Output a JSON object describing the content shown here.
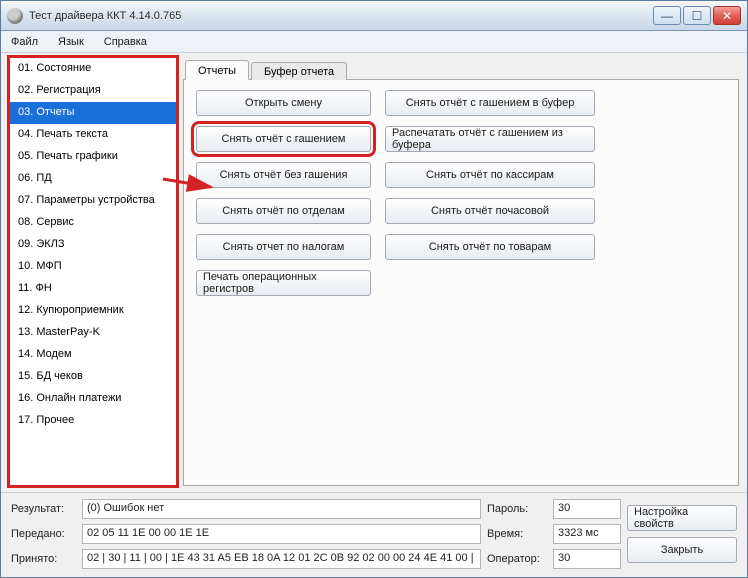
{
  "window": {
    "title": "Тест драйвера ККТ 4.14.0.765"
  },
  "menu": {
    "file": "Файл",
    "lang": "Язык",
    "help": "Справка"
  },
  "sidebar": {
    "items": [
      "01. Состояние",
      "02. Регистрация",
      "03. Отчеты",
      "04. Печать текста",
      "05. Печать графики",
      "06. ПД",
      "07. Параметры устройства",
      "08. Сервис",
      "09. ЭКЛЗ",
      "10. МФП",
      "11. ФН",
      "12. Купюроприемник",
      "13. MasterPay-K",
      "14. Модем",
      "15. БД чеков",
      "16. Онлайн платежи",
      "17. Прочее"
    ],
    "selected_index": 2
  },
  "tabs": {
    "reports": "Отчеты",
    "buffer": "Буфер отчета"
  },
  "buttons": {
    "open_shift": "Открыть смену",
    "z_report": "Снять отчёт с гашением",
    "x_report": "Снять отчёт без гашения",
    "by_dept": "Снять отчёт по отделам",
    "by_tax": "Снять отчет по налогам",
    "op_registers": "Печать операционных регистров",
    "z_to_buffer": "Снять отчёт с гашением в буфер",
    "z_from_buffer": "Распечатать отчёт с гашением из буфера",
    "by_cashiers": "Снять отчёт по кассирам",
    "hourly": "Снять отчёт почасовой",
    "by_goods": "Снять отчёт по товарам"
  },
  "status": {
    "result_label": "Результат:",
    "result_value": "(0) Ошибок нет",
    "sent_label": "Передано:",
    "sent_value": "02 05 11 1E 00 00 1E 1E",
    "recv_label": "Принято:",
    "recv_value": "02 | 30 | 11 | 00 | 1E 43 31 A5 EB 18 0A 12 01 2C 0B 92 02 00 00 24 4E 41 00 |",
    "password_label": "Пароль:",
    "password_value": "30",
    "time_label": "Время:",
    "time_value": "3323 мс",
    "operator_label": "Оператор:",
    "operator_value": "30",
    "props_btn": "Настройка свойств",
    "close_btn": "Закрыть"
  }
}
